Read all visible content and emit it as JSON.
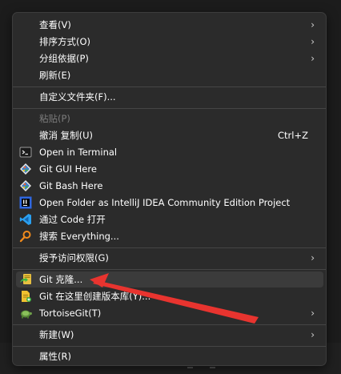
{
  "menu": {
    "view": {
      "label": "查看(V)"
    },
    "sort": {
      "label": "排序方式(O)"
    },
    "group": {
      "label": "分组依据(P)"
    },
    "refresh": {
      "label": "刷新(E)"
    },
    "customize": {
      "label": "自定义文件夹(F)..."
    },
    "paste": {
      "label": "粘贴(P)"
    },
    "undo": {
      "label": "撤消 复制(U)",
      "shortcut": "Ctrl+Z"
    },
    "terminal": {
      "label": "Open in Terminal"
    },
    "gitgui": {
      "label": "Git GUI Here"
    },
    "gitbash": {
      "label": "Git Bash Here"
    },
    "intellij": {
      "label": "Open Folder as IntelliJ IDEA Community Edition Project"
    },
    "vscode": {
      "label": "通过 Code 打开"
    },
    "everything": {
      "label": "搜索 Everything..."
    },
    "access": {
      "label": "授予访问权限(G)"
    },
    "gitclone": {
      "label": "Git 克隆..."
    },
    "gitcreate": {
      "label": "Git 在这里创建版本库(Y)..."
    },
    "tortoise": {
      "label": "TortoiseGit(T)"
    },
    "new": {
      "label": "新建(W)"
    },
    "properties": {
      "label": "属性(R)"
    }
  },
  "icons": {
    "terminal": "terminal-icon",
    "gitgui": "git-icon",
    "gitbash": "git-icon",
    "intellij": "intellij-icon",
    "vscode": "vscode-icon",
    "everything": "search-icon",
    "gitclone": "tortoisegit-clone-icon",
    "gitcreate": "tortoisegit-create-repo-icon",
    "tortoise": "tortoisegit-icon"
  },
  "colors": {
    "menu_bg": "#2b2b2b",
    "highlight": "#3b3b3b",
    "annotation_arrow": "#e8342f"
  }
}
